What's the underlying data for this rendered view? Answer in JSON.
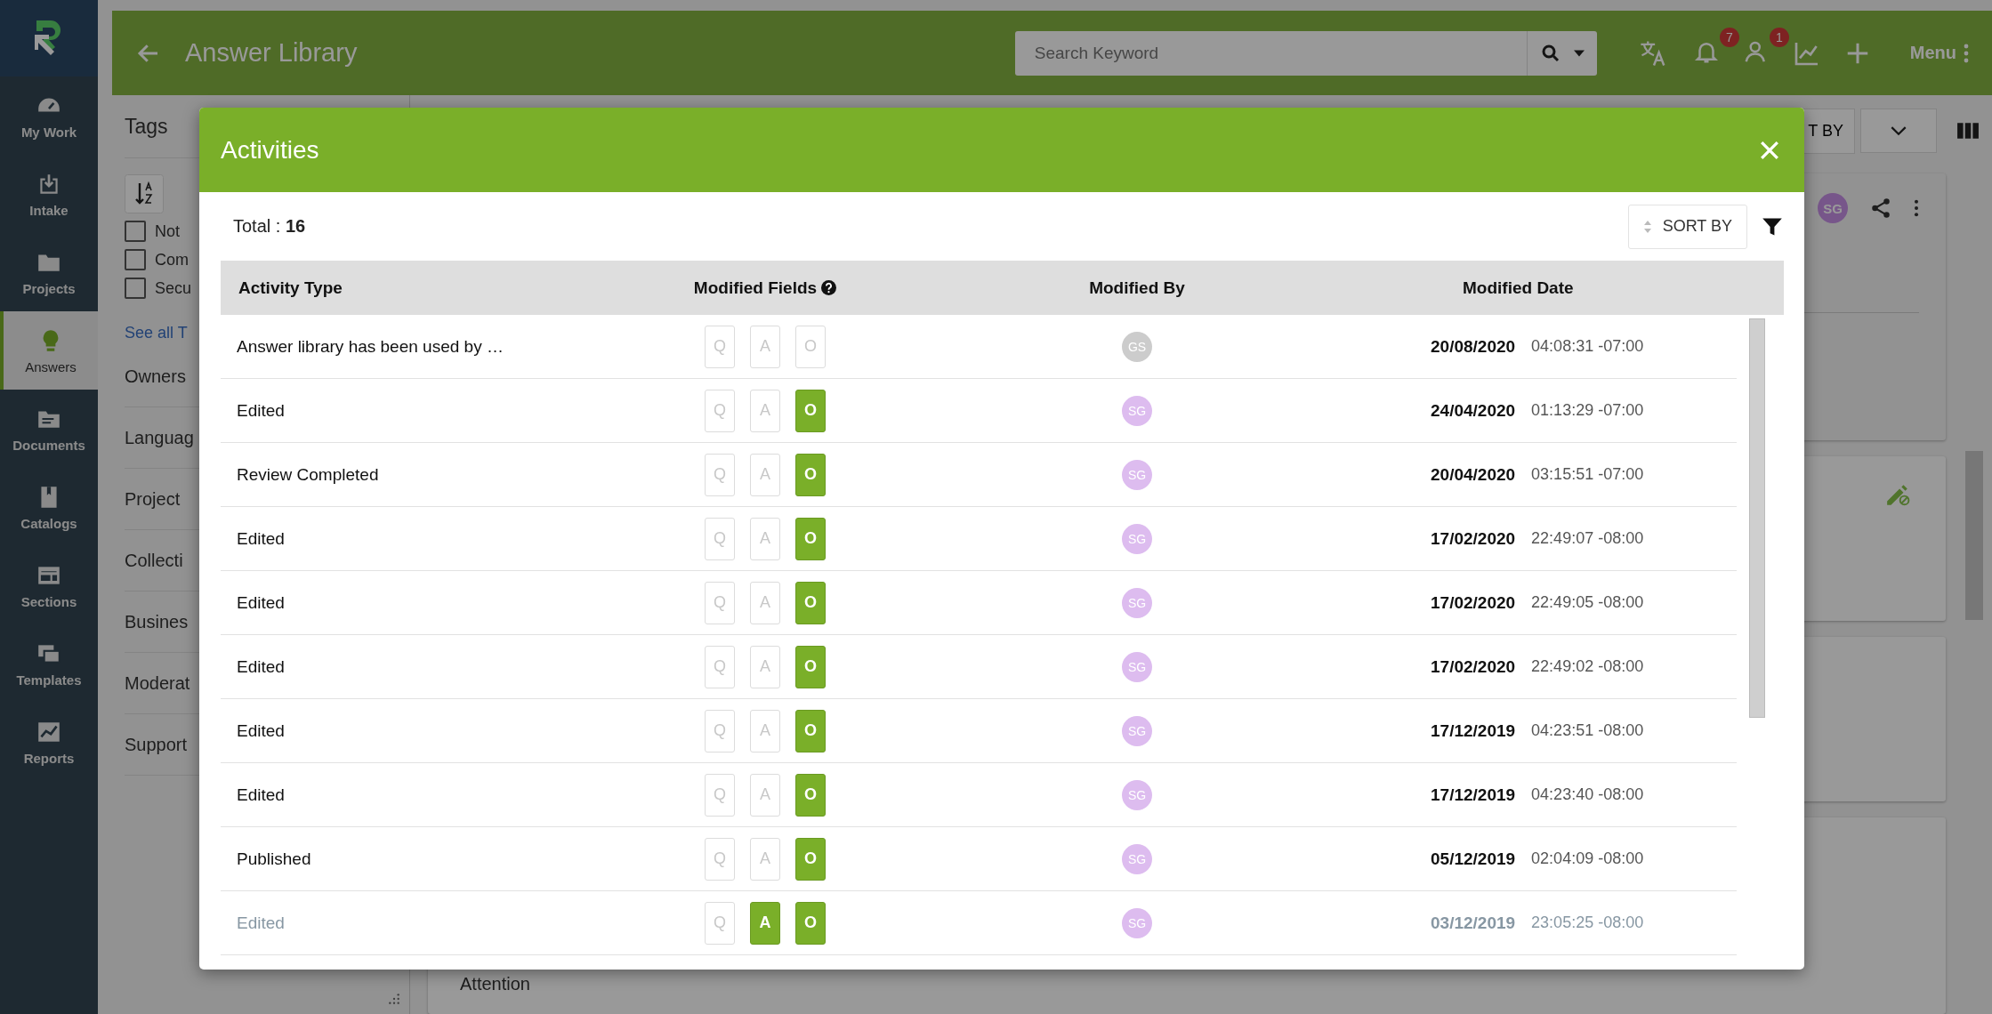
{
  "sidebar": {
    "items": [
      {
        "label": "My Work",
        "selected": false
      },
      {
        "label": "Intake",
        "selected": false
      },
      {
        "label": "Projects",
        "selected": false
      },
      {
        "label": "Answers",
        "selected": true
      },
      {
        "label": "Documents",
        "selected": false
      },
      {
        "label": "Catalogs",
        "selected": false
      },
      {
        "label": "Sections",
        "selected": false
      },
      {
        "label": "Templates",
        "selected": false
      },
      {
        "label": "Reports",
        "selected": false
      }
    ]
  },
  "header": {
    "title": "Answer Library",
    "search_placeholder": "Search Keyword",
    "notifications_badge": "7",
    "people_badge": "1",
    "menu_label": "Menu"
  },
  "filters": {
    "title": "Tags",
    "tags": [
      {
        "label": "Not",
        "checked": false
      },
      {
        "label": "Com",
        "checked": false
      },
      {
        "label": "Secu",
        "checked": false
      }
    ],
    "see_all": "See all T",
    "sections": [
      "Owners",
      "Languag",
      "Project",
      "Collecti",
      "Busines",
      "Moderat",
      "Support"
    ]
  },
  "toolbar": {
    "sort_label": "T BY"
  },
  "card": {
    "avatar": "SG",
    "footer_text": "Attention"
  },
  "modal": {
    "title": "Activities",
    "total": "Total : **16**",
    "sort_label": "SORT BY",
    "columns": [
      "Activity Type",
      "Modified Fields",
      "Modified By",
      "Modified Date"
    ],
    "rows": [
      {
        "activity": "Answer library has been used by …",
        "fields": [
          {
            "letter": "Q",
            "on": false
          },
          {
            "letter": "A",
            "on": false
          },
          {
            "letter": "O",
            "on": false
          }
        ],
        "avatar": "GS",
        "color": "#cccccc",
        "date": "20/08/2020",
        "time": "04:08:31 -07:00",
        "dimmed": false
      },
      {
        "activity": "Edited",
        "fields": [
          {
            "letter": "Q",
            "on": false
          },
          {
            "letter": "A",
            "on": false
          },
          {
            "letter": "O",
            "on": true
          }
        ],
        "avatar": "SG",
        "color": "#ddbcef",
        "date": "24/04/2020",
        "time": "01:13:29 -07:00",
        "dimmed": false
      },
      {
        "activity": "Review Completed",
        "fields": [
          {
            "letter": "Q",
            "on": false
          },
          {
            "letter": "A",
            "on": false
          },
          {
            "letter": "O",
            "on": true
          }
        ],
        "avatar": "SG",
        "color": "#ddbcef",
        "date": "20/04/2020",
        "time": "03:15:51 -07:00",
        "dimmed": false
      },
      {
        "activity": "Edited",
        "fields": [
          {
            "letter": "Q",
            "on": false
          },
          {
            "letter": "A",
            "on": false
          },
          {
            "letter": "O",
            "on": true
          }
        ],
        "avatar": "SG",
        "color": "#ddbcef",
        "date": "17/02/2020",
        "time": "22:49:07 -08:00",
        "dimmed": false
      },
      {
        "activity": "Edited",
        "fields": [
          {
            "letter": "Q",
            "on": false
          },
          {
            "letter": "A",
            "on": false
          },
          {
            "letter": "O",
            "on": true
          }
        ],
        "avatar": "SG",
        "color": "#ddbcef",
        "date": "17/02/2020",
        "time": "22:49:05 -08:00",
        "dimmed": false
      },
      {
        "activity": "Edited",
        "fields": [
          {
            "letter": "Q",
            "on": false
          },
          {
            "letter": "A",
            "on": false
          },
          {
            "letter": "O",
            "on": true
          }
        ],
        "avatar": "SG",
        "color": "#ddbcef",
        "date": "17/02/2020",
        "time": "22:49:02 -08:00",
        "dimmed": false
      },
      {
        "activity": "Edited",
        "fields": [
          {
            "letter": "Q",
            "on": false
          },
          {
            "letter": "A",
            "on": false
          },
          {
            "letter": "O",
            "on": true
          }
        ],
        "avatar": "SG",
        "color": "#ddbcef",
        "date": "17/12/2019",
        "time": "04:23:51 -08:00",
        "dimmed": false
      },
      {
        "activity": "Edited",
        "fields": [
          {
            "letter": "Q",
            "on": false
          },
          {
            "letter": "A",
            "on": false
          },
          {
            "letter": "O",
            "on": true
          }
        ],
        "avatar": "SG",
        "color": "#ddbcef",
        "date": "17/12/2019",
        "time": "04:23:40 -08:00",
        "dimmed": false
      },
      {
        "activity": "Published",
        "fields": [
          {
            "letter": "Q",
            "on": false
          },
          {
            "letter": "A",
            "on": false
          },
          {
            "letter": "O",
            "on": true
          }
        ],
        "avatar": "SG",
        "color": "#ddbcef",
        "date": "05/12/2019",
        "time": "02:04:09 -08:00",
        "dimmed": false
      },
      {
        "activity": "Edited",
        "fields": [
          {
            "letter": "Q",
            "on": false
          },
          {
            "letter": "A",
            "on": true
          },
          {
            "letter": "O",
            "on": true
          }
        ],
        "avatar": "SG",
        "color": "#ddbcef",
        "date": "03/12/2019",
        "time": "23:05:25 -08:00",
        "dimmed": true
      }
    ]
  }
}
